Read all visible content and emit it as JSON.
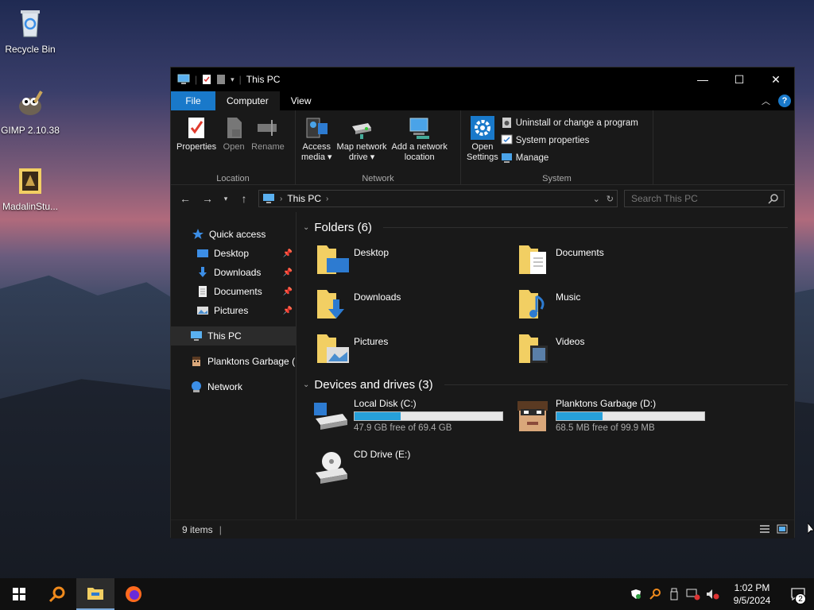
{
  "desktop": {
    "icons": [
      {
        "label": "Recycle Bin",
        "icon": "recycle-bin-icon"
      },
      {
        "label": "GIMP 2.10.38",
        "icon": "gimp-icon"
      },
      {
        "label": "MadalinStu...",
        "icon": "game-folder-icon"
      }
    ]
  },
  "window": {
    "title": "This PC",
    "tabs": {
      "file": "File",
      "computer": "Computer",
      "view": "View"
    },
    "help": "?"
  },
  "ribbon": {
    "location": {
      "label": "Location",
      "properties": "Properties",
      "open": "Open",
      "rename": "Rename"
    },
    "network": {
      "label": "Network",
      "access_media": [
        "Access",
        "media ▾"
      ],
      "map_drive": [
        "Map network",
        "drive ▾"
      ],
      "add_location": [
        "Add a network",
        "location"
      ]
    },
    "system": {
      "label": "System",
      "open_settings": [
        "Open",
        "Settings"
      ],
      "uninstall": "Uninstall or change a program",
      "system_properties": "System properties",
      "manage": "Manage"
    }
  },
  "address": {
    "path": "This PC",
    "search_placeholder": "Search This PC"
  },
  "nav": {
    "quick_access": "Quick access",
    "items": [
      {
        "label": "Desktop",
        "pinned": true
      },
      {
        "label": "Downloads",
        "pinned": true
      },
      {
        "label": "Documents",
        "pinned": true
      },
      {
        "label": "Pictures",
        "pinned": true
      }
    ],
    "this_pc": "This PC",
    "drive_d": "Planktons Garbage (D",
    "network": "Network"
  },
  "folders": {
    "heading": "Folders (6)",
    "items": [
      "Desktop",
      "Documents",
      "Downloads",
      "Music",
      "Pictures",
      "Videos"
    ]
  },
  "drives": {
    "heading": "Devices and drives (3)",
    "items": [
      {
        "name": "Local Disk (C:)",
        "free": "47.9 GB free of 69.4 GB",
        "used_fraction": 0.31
      },
      {
        "name": "Planktons Garbage (D:)",
        "free": "68.5 MB free of 99.9 MB",
        "used_fraction": 0.31
      },
      {
        "name": "CD Drive (E:)"
      }
    ]
  },
  "status": {
    "count": "9 items"
  },
  "taskbar": {
    "time": "1:02 PM",
    "date": "9/5/2024",
    "notifications": "2"
  }
}
